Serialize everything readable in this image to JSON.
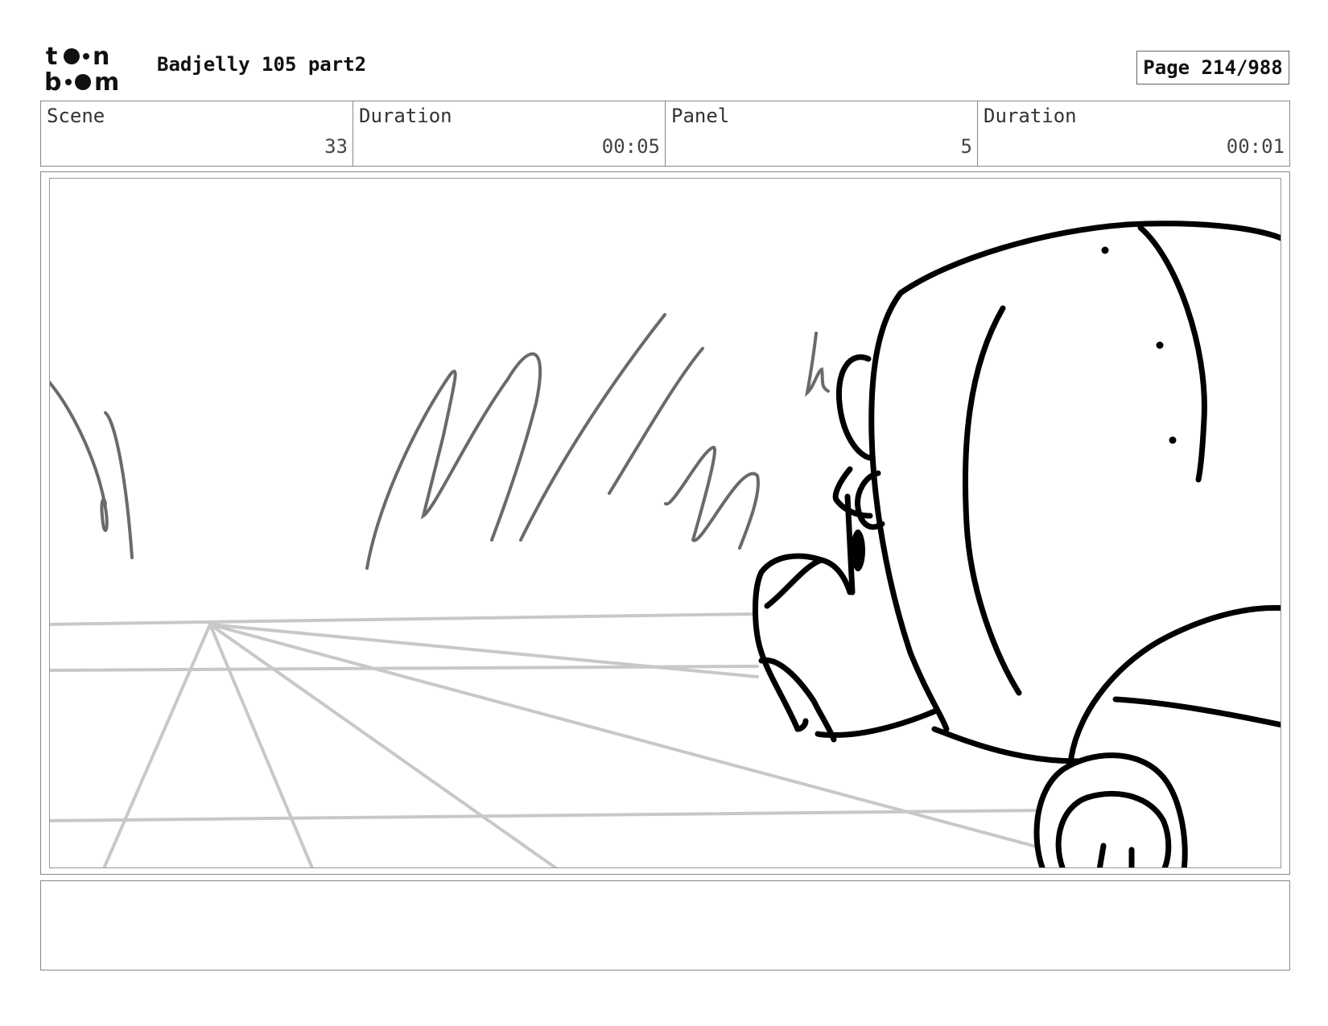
{
  "header": {
    "logo_line1": "toon",
    "logo_line2": "boom",
    "project_title": "Badjelly 105 part2",
    "page_label": "Page 214/988"
  },
  "info": {
    "scene_label": "Scene",
    "scene_value": "33",
    "scene_duration_label": "Duration",
    "scene_duration_value": "00:05",
    "panel_label": "Panel",
    "panel_value": "5",
    "panel_duration_label": "Duration",
    "panel_duration_value": "00:01"
  },
  "notes": {
    "text": ""
  }
}
